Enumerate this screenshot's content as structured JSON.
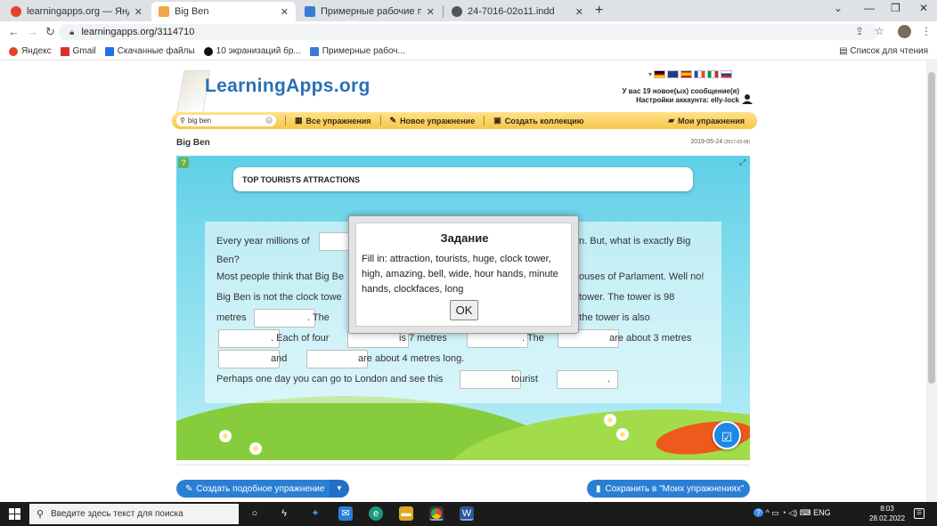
{
  "browser": {
    "tabs": [
      {
        "label": "learningapps.org — Яндекс: наш",
        "favicon_color": "#e8402a",
        "active": false
      },
      {
        "label": "Big Ben",
        "favicon_color": "#f2a64a",
        "active": true
      },
      {
        "label": "Примерные рабочие программы",
        "favicon_color": "#3b7bd6",
        "active": false
      },
      {
        "label": "24-7016-02o11.indd",
        "favicon_color": "#555555",
        "active": false
      }
    ],
    "url": "learningapps.org/3114710",
    "bookmarks": [
      {
        "label": "Яндекс",
        "color": "#e8402a"
      },
      {
        "label": "Gmail",
        "color": "#d93025"
      },
      {
        "label": "Скачанные файлы",
        "color": "#1a73e8"
      },
      {
        "label": "10 экранизаций бр...",
        "color": "#111111"
      },
      {
        "label": "Примерные рабоч...",
        "color": "#3b7bd6"
      }
    ],
    "reading_list": "Список для чтения"
  },
  "site": {
    "logo": "LearningApps.org",
    "messages": "У вас 19 новое(ых) сообщение(я)",
    "account": "Настройки аккаунта: elly-lock",
    "search_value": "big ben",
    "menu": {
      "all_exercises": "Все упражнения",
      "new_exercise": "Новое упражнение",
      "create_collection": "Создать коллекцию",
      "my_exercises": "Мои упражнения"
    },
    "page_title": "Big Ben",
    "date_main": "2019-05-24",
    "date_small": "(2017-02-08)"
  },
  "exercise": {
    "title": "TOP TOURISTS ATTRACTIONS",
    "lines": {
      "l1a": "Every year millions of",
      "l1b": "n. But, what is exactly Big",
      "l2": "Ben?",
      "l3a": "Most people think that Big Be",
      "l3b": "ouses of Parlament. Well no!",
      "l4a": "Big Ben is not the clock towe",
      "l4b": "tower. The tower is 98",
      "l5a": "metres",
      "l5b": ". The",
      "l5c": "on the tower is also",
      "l6a": ". Each of four",
      "l6b": "is 7 metres",
      "l6c": ". The",
      "l6d": "are about 3 metres",
      "l7a": "and",
      "l7b": "are about 4 metres long.",
      "l8a": "Perhaps one day you can go to London and see this",
      "l8b": "tourist",
      "l8c": "."
    }
  },
  "modal": {
    "title": "Задание",
    "body": "Fill in: attraction, tourists, huge, clock tower, high, amazing, bell, wide, hour hands, minute hands, clockfaces, long",
    "ok": "OK"
  },
  "footer": {
    "create_similar": "Создать подобное упражнение",
    "save": "Сохранить в \"Моих упражнениях\""
  },
  "taskbar": {
    "search_placeholder": "Введите здесь текст для поиска",
    "lang": "ENG",
    "time": "8:03",
    "date": "28.02.2022"
  }
}
